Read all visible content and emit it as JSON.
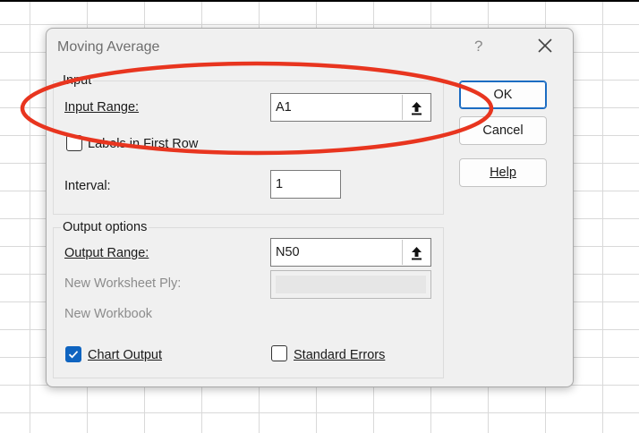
{
  "dialog": {
    "title": "Moving Average",
    "help_glyph": "?",
    "close_icon": "close-icon"
  },
  "input_group": {
    "label": "Input",
    "input_range_label": "Input Range:",
    "input_range_value": "A1",
    "labels_first_row_label": "Labels in First Row",
    "labels_first_row_checked": false,
    "interval_label": "Interval:",
    "interval_value": "1"
  },
  "output_group": {
    "label": "Output options",
    "output_range_label": "Output Range:",
    "output_range_value": "N50",
    "new_worksheet_label": "New Worksheet Ply:",
    "new_workbook_label": "New Workbook",
    "chart_output_label": "Chart Output",
    "chart_output_checked": true,
    "standard_errors_label": "Standard Errors",
    "standard_errors_checked": false
  },
  "buttons": {
    "ok": "OK",
    "cancel": "Cancel",
    "help": "Help"
  },
  "annotation": {
    "color": "#e8351f",
    "shape": "ellipse"
  },
  "colors": {
    "checkbox_checked": "#0f64c0",
    "default_button_border": "#1b6cc2"
  }
}
